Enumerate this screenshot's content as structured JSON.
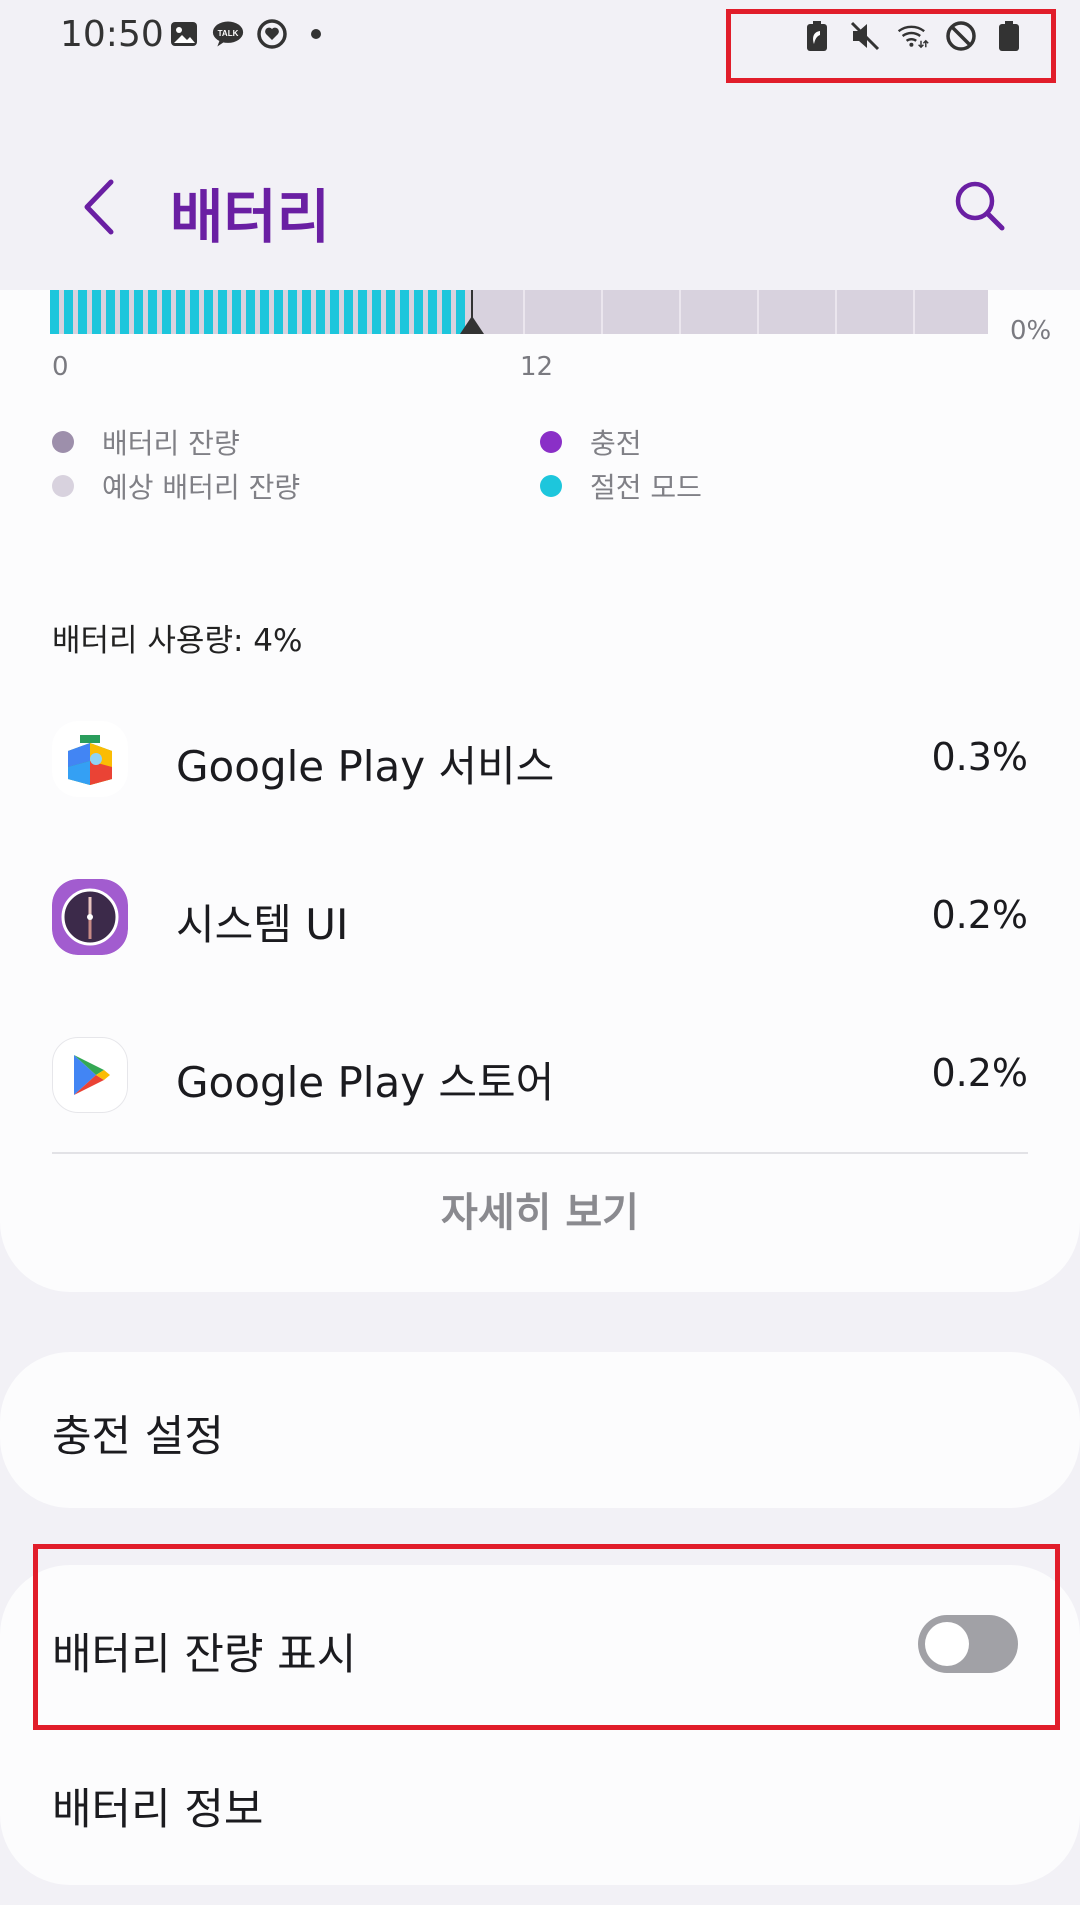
{
  "status_bar": {
    "time": "10:50",
    "left_icons": [
      "gallery-icon",
      "kakaotalk-icon",
      "heart-app-icon",
      "dot-icon"
    ],
    "right_icons": [
      "battery-saver-icon",
      "mute-icon",
      "wifi-icon",
      "block-icon",
      "battery-icon"
    ]
  },
  "header": {
    "title": "배터리",
    "back_icon": "chevron-left-icon",
    "search_icon": "search-icon"
  },
  "chart_data": {
    "type": "bar",
    "x_tick_labels": [
      "0",
      "12"
    ],
    "y_label": "0%",
    "filled_fraction": 0.45,
    "legend": [
      {
        "label": "배터리 잔량",
        "color": "#9d8fab"
      },
      {
        "label": "예상 배터리 잔량",
        "color": "#d8d2de"
      },
      {
        "label": "충전",
        "color": "#8a2fc7"
      },
      {
        "label": "절전 모드",
        "color": "#1dc6dc"
      }
    ]
  },
  "usage": {
    "title": "배터리 사용량: 4%",
    "apps": [
      {
        "name": "Google Play 서비스",
        "percent": "0.3%",
        "icon": "google-play-services-icon"
      },
      {
        "name": "시스템 UI",
        "percent": "0.2%",
        "icon": "system-ui-icon"
      },
      {
        "name": "Google Play 스토어",
        "percent": "0.2%",
        "icon": "google-play-store-icon"
      }
    ],
    "details_label": "자세히 보기"
  },
  "settings": {
    "charging": "충전 설정",
    "show_percentage": "배터리 잔량 표시",
    "show_percentage_enabled": false,
    "battery_info": "배터리 정보"
  },
  "colors": {
    "accent": "#6a1fa3",
    "saver": "#1dc6dc",
    "highlight": "#e11d2a"
  }
}
